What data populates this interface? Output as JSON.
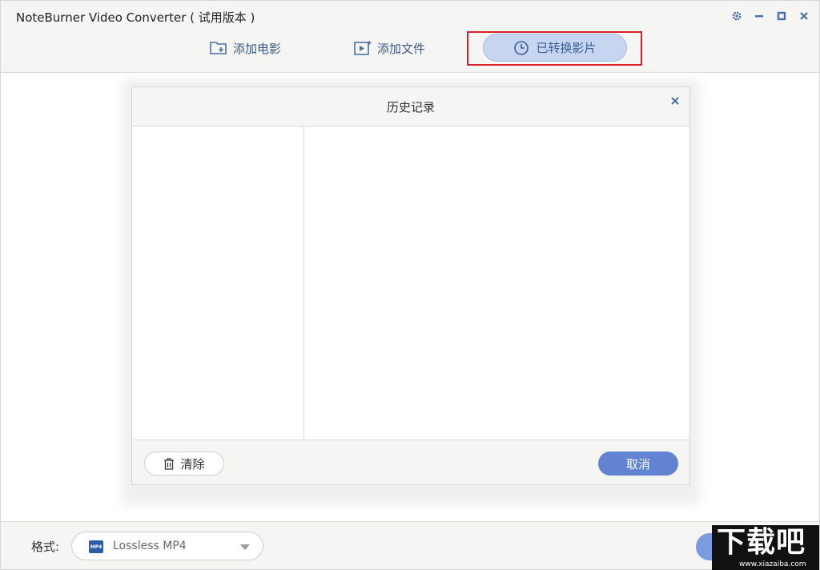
{
  "app": {
    "title": "NoteBurner Video Converter ( 试用版本 )"
  },
  "nav": {
    "add_movie": "添加电影",
    "add_file": "添加文件",
    "converted": "已转换影片"
  },
  "dialog": {
    "title": "历史记录",
    "clear_label": "清除",
    "cancel_label": "取消"
  },
  "bottom": {
    "format_label": "格式:",
    "format_value": "Lossless MP4",
    "format_icon_text": "MP4"
  },
  "watermark": {
    "main": "下载吧",
    "url": "www.xiazaiba.com"
  },
  "colors": {
    "accent": "#6183d2",
    "highlight_border": "#d9202a",
    "nav_text": "#3b5a8a",
    "active_pill": "#c6d6f1"
  }
}
